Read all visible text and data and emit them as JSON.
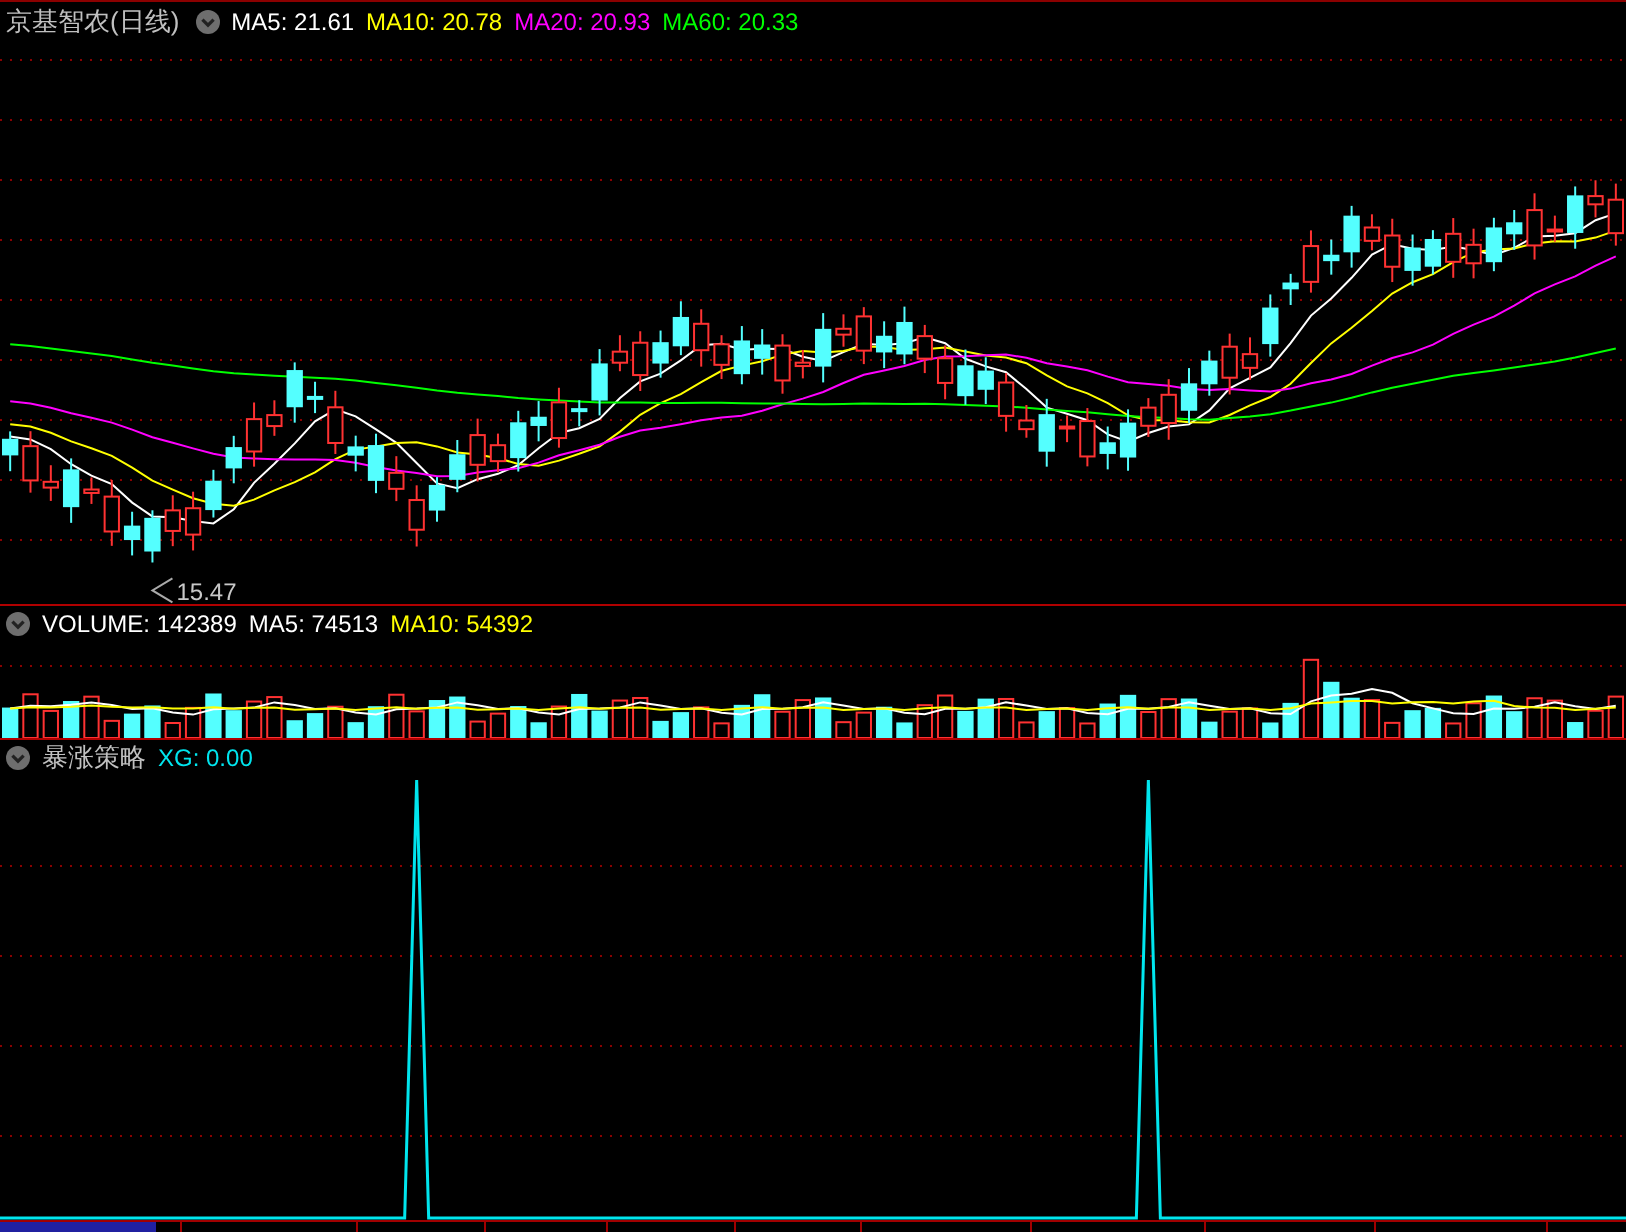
{
  "price_panel": {
    "title": "京基智农(日线)",
    "indicators": [
      {
        "label": "MA5: 21.61",
        "color": "#ffffff"
      },
      {
        "label": "MA10: 20.78",
        "color": "#ffff00"
      },
      {
        "label": "MA20: 20.93",
        "color": "#ff00ff"
      },
      {
        "label": "MA60: 20.33",
        "color": "#00ff00"
      }
    ],
    "low_marker": "15.47"
  },
  "volume_panel": {
    "indicators": [
      {
        "label": "VOLUME: 142389",
        "color": "#ffffff"
      },
      {
        "label": "MA5: 74513",
        "color": "#ffffff"
      },
      {
        "label": "MA10: 54392",
        "color": "#ffff00"
      }
    ]
  },
  "signal_panel": {
    "title": "暴涨策略",
    "indicators": [
      {
        "label": "XG: 0.00",
        "color": "#00e5ee"
      }
    ]
  }
}
